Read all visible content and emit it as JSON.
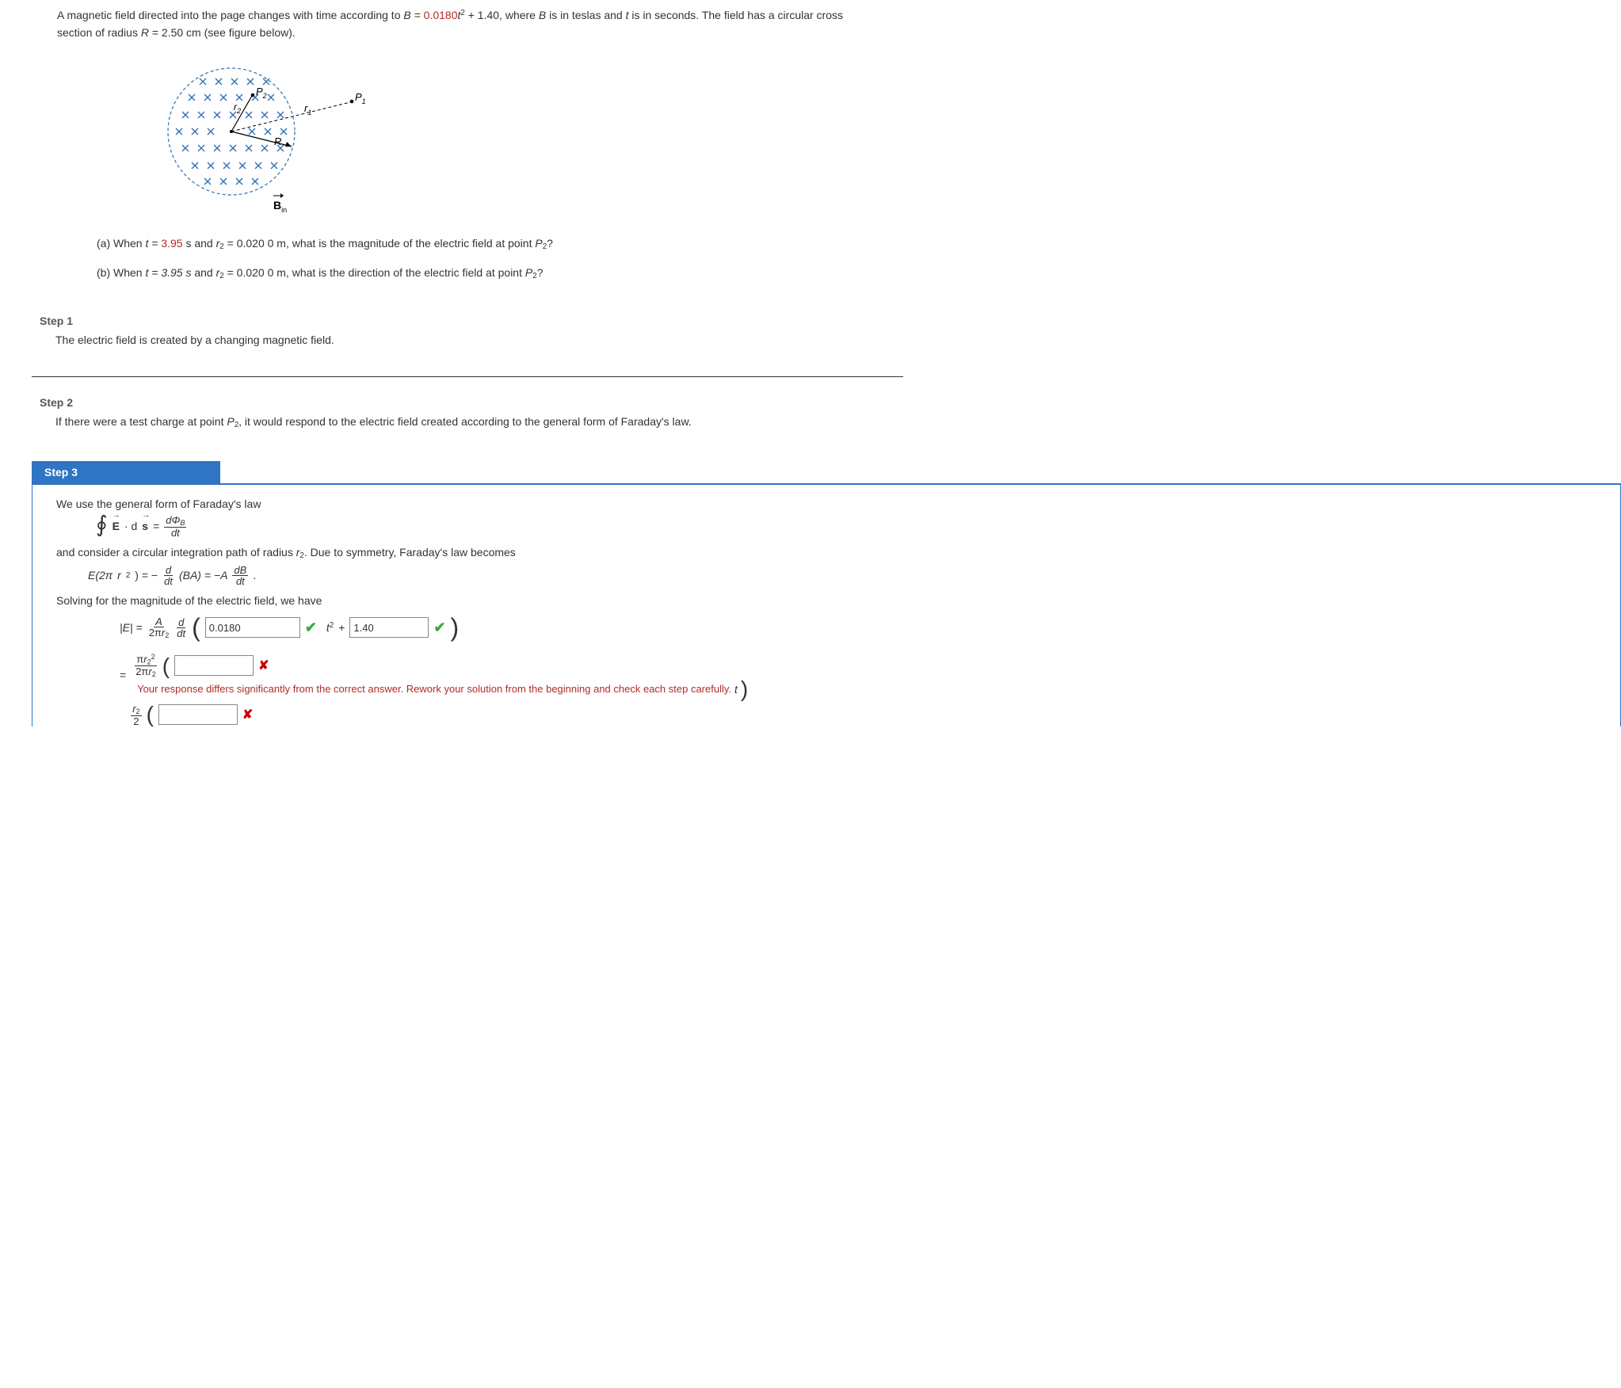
{
  "problem": {
    "p1a": "A magnetic field directed into the page changes with time according to ",
    "eqB_lhs": "B = ",
    "eqB_coef": "0.0180",
    "eqB_mid": "t",
    "eqB_sq": "2",
    "eqB_plus": " + 1.40,",
    "p1b": " where ",
    "Bvar": "B",
    "p1c": " is in teslas and ",
    "tvar": "t",
    "p1d": " is in seconds. The field has a circular cross section of radius ",
    "Rvar": "R",
    "Rval": " = 2.50 cm",
    "p1e": " (see figure below).",
    "a_label": "(a) When ",
    "a_t": "t = ",
    "a_tval": "3.95",
    "a_tunit": " s",
    "a_and": " and ",
    "a_r2": "r",
    "a_r2sub": "2",
    "a_r2val": " = 0.020 0 m,",
    "a_q": " what is the magnitude of the electric field at point ",
    "a_P2": "P",
    "a_P2sub": "2",
    "a_qm": "?",
    "b_label": "(b) When ",
    "b_t": "t = 3.95 s",
    "b_and": " and ",
    "b_r2val": " = 0.020 0 m,",
    "b_q": " what is the direction of the electric field at point "
  },
  "figure": {
    "P1": "P",
    "P1sub": "1",
    "P2": "P",
    "P2sub": "2",
    "r1": "r",
    "r1sub": "1",
    "r2": "r",
    "r2sub": "2",
    "R": "R",
    "Bin_B": "B",
    "Bin_sub": "in"
  },
  "step1": {
    "title": "Step 1",
    "text": "The electric field is created by a changing magnetic field."
  },
  "step2": {
    "title": "Step 2",
    "text_a": "If there were a test charge at point ",
    "P2": "P",
    "P2sub": "2",
    "text_b": ", it would respond to the electric field created according to the general form of Faraday's law."
  },
  "step3": {
    "title": "Step 3",
    "line1": "We use the general form of Faraday's law",
    "faraday_lhs_E": "E",
    "faraday_dot": " · d",
    "faraday_s": "s",
    "faraday_eq": " = ",
    "faraday_num": "dΦ",
    "faraday_num_sub": "B",
    "faraday_den": "dt",
    "line2a": "and consider a circular integration path of radius ",
    "line2_r2": "r",
    "line2_r2sub": "2",
    "line2b": ". Due to symmetry, Faraday's law becomes",
    "eq2_lhs": "E(2π",
    "eq2_r2": "r",
    "eq2_r2sub": "2",
    "eq2_lhs_close": ") = − ",
    "eq2_frac_num": "d",
    "eq2_frac_den": "dt",
    "eq2_BA": "(BA) = −A",
    "eq2_dB": "dB",
    "eq2_dt": "dt",
    "eq2_dot": ".",
    "line3": "Solving for the magnitude of the electric field, we have",
    "E_abs": "|E| = ",
    "Afrac_num": "A",
    "Afrac_den_2pi": "2π",
    "Afrac_den_r2": "r",
    "Afrac_den_r2sub": "2",
    "d_dt_num": "d",
    "d_dt_den": "dt",
    "input1_value": "0.0180",
    "t2": "t",
    "t2sup": "2",
    "plus": " + ",
    "input2_value": "1.40",
    "pir2_num_pi": "π",
    "pir2_num_r": "r",
    "pir2_num_sub": "2",
    "pir2_num_sq": "2",
    "pir2_den_2pi": "2π",
    "pir2_den_r": "r",
    "pir2_den_sub": "2",
    "input3_value": "",
    "feedback": "Your response differs significantly from the correct answer. Rework your solution from the beginning and check each step carefully.",
    "t_suffix": "t",
    "r2over2_num": "r",
    "r2over2_num_sub": "2",
    "r2over2_den": "2",
    "input4_value": ""
  }
}
